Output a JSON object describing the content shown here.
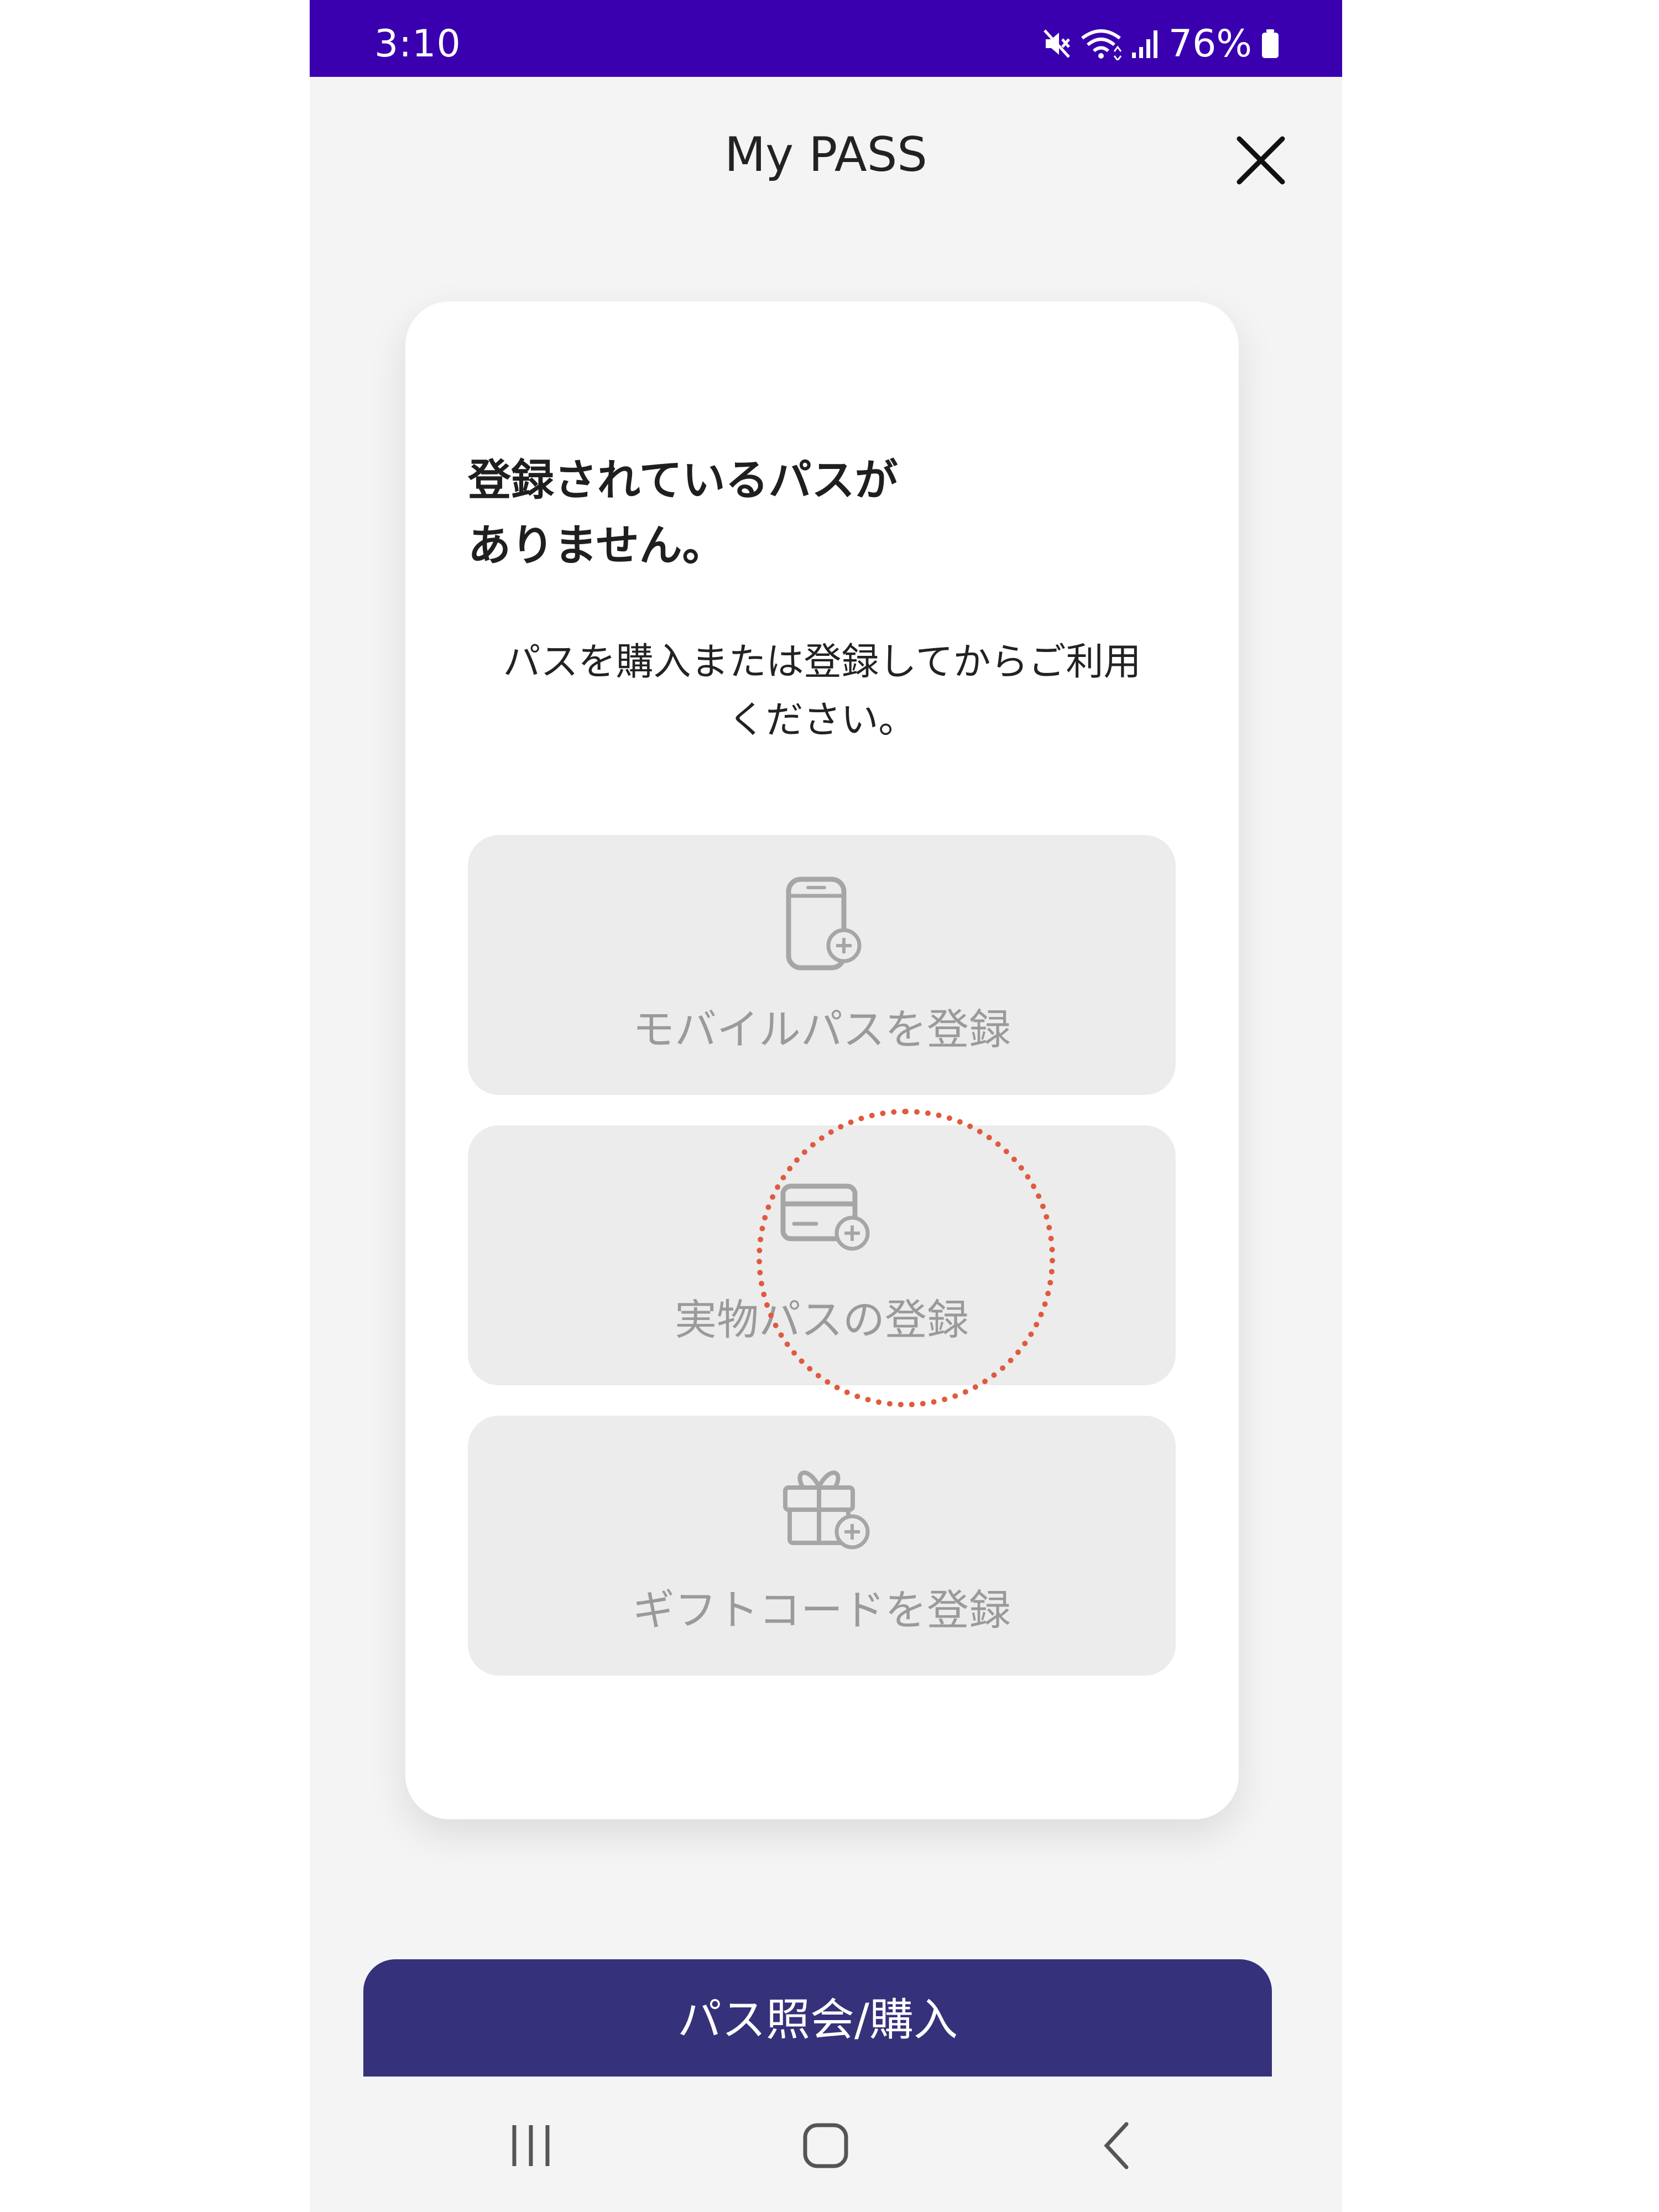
{
  "status_bar": {
    "time": "3:10",
    "battery_percent": "76%",
    "icons": [
      "mute-icon",
      "wifi-icon",
      "signal-icon",
      "battery-icon"
    ],
    "color": "#3a00b0"
  },
  "header": {
    "title": "My PASS",
    "close_icon": "close-icon"
  },
  "card": {
    "heading_line1": "登録されているパスが",
    "heading_line2": "ありません。",
    "subtext_line1": "パスを購入または登録してからご利用",
    "subtext_line2": "ください。",
    "options": [
      {
        "label": "モバイルパスを登録",
        "icon": "mobile-add-icon"
      },
      {
        "label": "実物パスの登録",
        "icon": "card-add-icon"
      },
      {
        "label": "ギフトコードを登録",
        "icon": "gift-add-icon"
      }
    ]
  },
  "cta": {
    "label": "パス照会/購入",
    "color": "#35317a"
  },
  "nav_bar": {
    "buttons": [
      "recent-apps-icon",
      "home-icon",
      "back-icon"
    ]
  }
}
